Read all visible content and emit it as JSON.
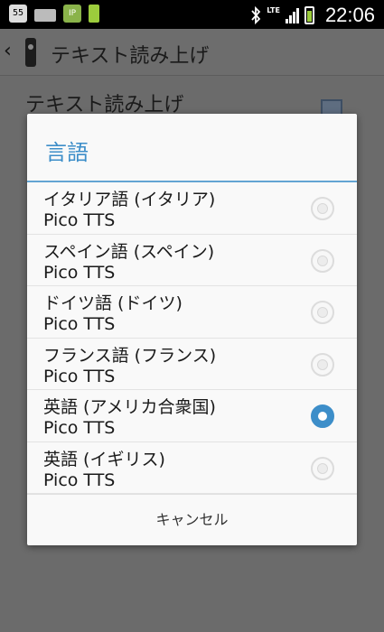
{
  "status_bar": {
    "calendar_day": "55",
    "network_label": "LTE",
    "time": "22:06",
    "notification_icons": [
      "calendar-icon",
      "keyboard-icon",
      "ip-icon",
      "battery-app-icon"
    ],
    "system_icons": [
      "bluetooth-icon",
      "signal-icon",
      "battery-icon"
    ]
  },
  "app_bar": {
    "back_icon": "chevron-left-icon",
    "app_icon": "app-icon",
    "title": "テキスト読み上げ"
  },
  "background": {
    "setting_label": "テキスト読み上げ",
    "checkbox_checked": true
  },
  "dialog": {
    "title": "言語",
    "accent_color": "#3d8ec9",
    "options": [
      {
        "label": "イタリア語 (イタリア)",
        "engine": "Pico TTS",
        "selected": false
      },
      {
        "label": "スペイン語 (スペイン)",
        "engine": "Pico TTS",
        "selected": false
      },
      {
        "label": "ドイツ語 (ドイツ)",
        "engine": "Pico TTS",
        "selected": false
      },
      {
        "label": "フランス語 (フランス)",
        "engine": "Pico TTS",
        "selected": false
      },
      {
        "label": "英語 (アメリカ合衆国)",
        "engine": "Pico TTS",
        "selected": true
      },
      {
        "label": "英語 (イギリス)",
        "engine": "Pico TTS",
        "selected": false
      }
    ],
    "cancel_label": "キャンセル"
  }
}
